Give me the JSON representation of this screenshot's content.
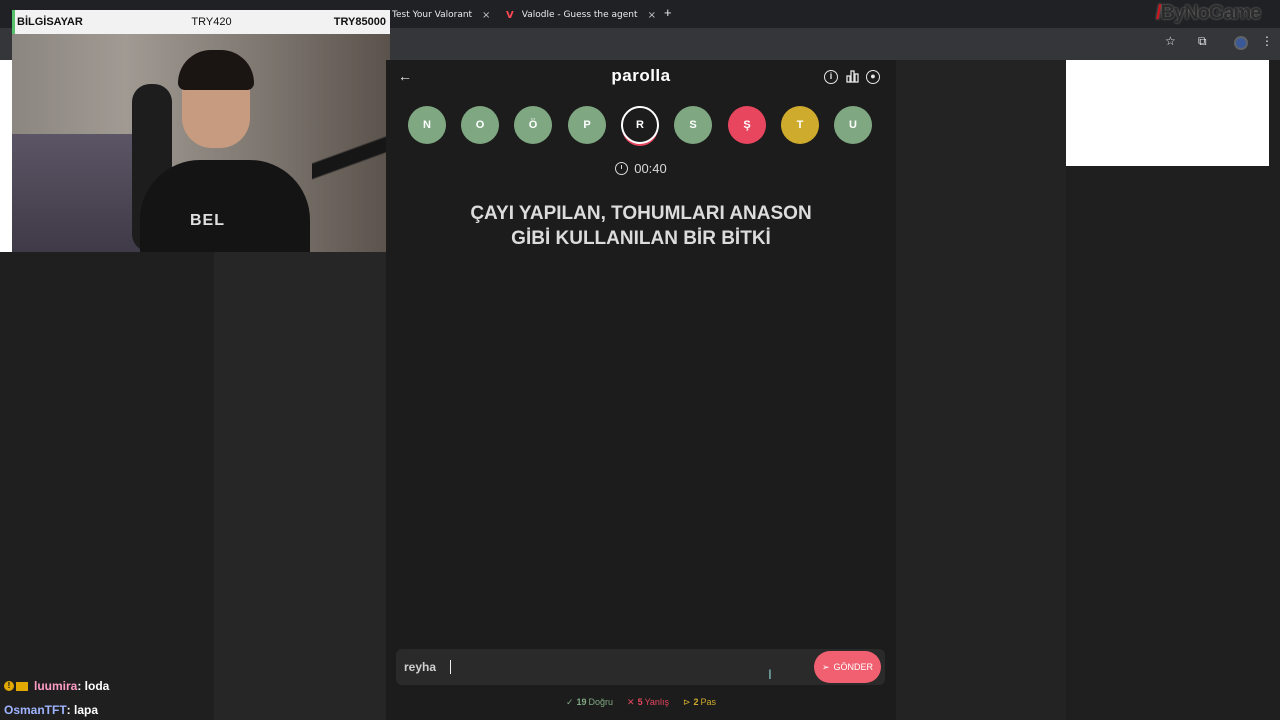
{
  "browser": {
    "tabs": [
      {
        "label": "Test Your Valorant Knov"
      },
      {
        "label": "Valodle - Guess the agent"
      }
    ],
    "new_tab": "+",
    "close": "×",
    "sponsor": {
      "mark": "/",
      "text": "ByNoGame"
    }
  },
  "overlay": {
    "left": "BİLGİSAYAR",
    "mid": "TRY420",
    "right": "TRY85000"
  },
  "webcam": {
    "shirt_text": "BEL"
  },
  "app": {
    "title": "parolla",
    "back_glyph": "←",
    "letters": [
      {
        "char": "N",
        "state": "green"
      },
      {
        "char": "O",
        "state": "green"
      },
      {
        "char": "Ö",
        "state": "green"
      },
      {
        "char": "P",
        "state": "green"
      },
      {
        "char": "R",
        "state": "active"
      },
      {
        "char": "S",
        "state": "green"
      },
      {
        "char": "Ş",
        "state": "red"
      },
      {
        "char": "T",
        "state": "yellow"
      },
      {
        "char": "U",
        "state": "green"
      }
    ],
    "timer": "00:40",
    "question_line1": "ÇAYI YAPILAN, TOHUMLARI ANASON",
    "question_line2": "GİBİ KULLANILAN BİR BİTKİ",
    "answer_value": "reyha",
    "send_label": "GÖNDER",
    "score": {
      "correct_count": "19",
      "correct_label": "Doğru",
      "wrong_count": "5",
      "wrong_label": "Yanlış",
      "pass_count": "2",
      "pass_label": "Pas"
    }
  },
  "chat": [
    {
      "user": "luumira",
      "message": ": loda"
    },
    {
      "user": "OsmanTFT",
      "message": ": lapa"
    }
  ],
  "colors": {
    "correct": "#7fa882",
    "wrong": "#e8465f",
    "pass": "#ceab2c",
    "send": "#f06070"
  }
}
